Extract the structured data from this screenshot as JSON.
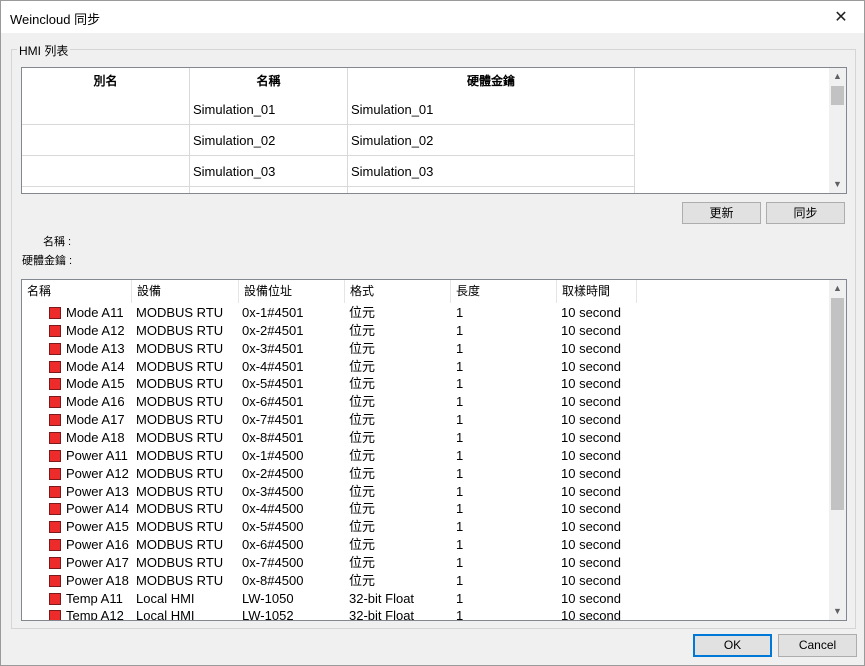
{
  "window": {
    "title": "Weincloud 同步",
    "close_glyph": "✕"
  },
  "group": {
    "label": "HMI 列表"
  },
  "hmi_table": {
    "columns": [
      "別名",
      "名稱",
      "硬體金鑰"
    ],
    "rows": [
      {
        "alias": "",
        "name": "Simulation_01",
        "key": "Simulation_01"
      },
      {
        "alias": "",
        "name": "Simulation_02",
        "key": "Simulation_02"
      },
      {
        "alias": "",
        "name": "Simulation_03",
        "key": "Simulation_03"
      }
    ]
  },
  "buttons": {
    "refresh": "更新",
    "sync": "同步",
    "ok": "OK",
    "cancel": "Cancel"
  },
  "info": {
    "name_label": "名稱 :",
    "key_label": "硬體金鑰 :"
  },
  "tag_list": {
    "columns": [
      "名稱",
      "設備",
      "設備位址",
      "格式",
      "長度",
      "取樣時間"
    ],
    "rows": [
      {
        "name": "Mode A11",
        "device": "MODBUS RTU",
        "address": "0x-1#4501",
        "format": "位元",
        "length": "1",
        "sample": "10 second"
      },
      {
        "name": "Mode A12",
        "device": "MODBUS RTU",
        "address": "0x-2#4501",
        "format": "位元",
        "length": "1",
        "sample": "10 second"
      },
      {
        "name": "Mode A13",
        "device": "MODBUS RTU",
        "address": "0x-3#4501",
        "format": "位元",
        "length": "1",
        "sample": "10 second"
      },
      {
        "name": "Mode A14",
        "device": "MODBUS RTU",
        "address": "0x-4#4501",
        "format": "位元",
        "length": "1",
        "sample": "10 second"
      },
      {
        "name": "Mode A15",
        "device": "MODBUS RTU",
        "address": "0x-5#4501",
        "format": "位元",
        "length": "1",
        "sample": "10 second"
      },
      {
        "name": "Mode A16",
        "device": "MODBUS RTU",
        "address": "0x-6#4501",
        "format": "位元",
        "length": "1",
        "sample": "10 second"
      },
      {
        "name": "Mode A17",
        "device": "MODBUS RTU",
        "address": "0x-7#4501",
        "format": "位元",
        "length": "1",
        "sample": "10 second"
      },
      {
        "name": "Mode A18",
        "device": "MODBUS RTU",
        "address": "0x-8#4501",
        "format": "位元",
        "length": "1",
        "sample": "10 second"
      },
      {
        "name": "Power A11",
        "device": "MODBUS RTU",
        "address": "0x-1#4500",
        "format": "位元",
        "length": "1",
        "sample": "10 second"
      },
      {
        "name": "Power A12",
        "device": "MODBUS RTU",
        "address": "0x-2#4500",
        "format": "位元",
        "length": "1",
        "sample": "10 second"
      },
      {
        "name": "Power A13",
        "device": "MODBUS RTU",
        "address": "0x-3#4500",
        "format": "位元",
        "length": "1",
        "sample": "10 second"
      },
      {
        "name": "Power A14",
        "device": "MODBUS RTU",
        "address": "0x-4#4500",
        "format": "位元",
        "length": "1",
        "sample": "10 second"
      },
      {
        "name": "Power A15",
        "device": "MODBUS RTU",
        "address": "0x-5#4500",
        "format": "位元",
        "length": "1",
        "sample": "10 second"
      },
      {
        "name": "Power A16",
        "device": "MODBUS RTU",
        "address": "0x-6#4500",
        "format": "位元",
        "length": "1",
        "sample": "10 second"
      },
      {
        "name": "Power A17",
        "device": "MODBUS RTU",
        "address": "0x-7#4500",
        "format": "位元",
        "length": "1",
        "sample": "10 second"
      },
      {
        "name": "Power A18",
        "device": "MODBUS RTU",
        "address": "0x-8#4500",
        "format": "位元",
        "length": "1",
        "sample": "10 second"
      },
      {
        "name": "Temp A11",
        "device": "Local HMI",
        "address": "LW-1050",
        "format": "32-bit Float",
        "length": "1",
        "sample": "10 second"
      },
      {
        "name": "Temp A12",
        "device": "Local HMI",
        "address": "LW-1052",
        "format": "32-bit Float",
        "length": "1",
        "sample": "10 second"
      }
    ]
  },
  "icons": {
    "tag_icon": "red-square-icon",
    "scroll_up": "▲",
    "scroll_down": "▼"
  },
  "colors": {
    "tag_icon": "#ee2b2b",
    "ok_border": "#0078d7"
  }
}
